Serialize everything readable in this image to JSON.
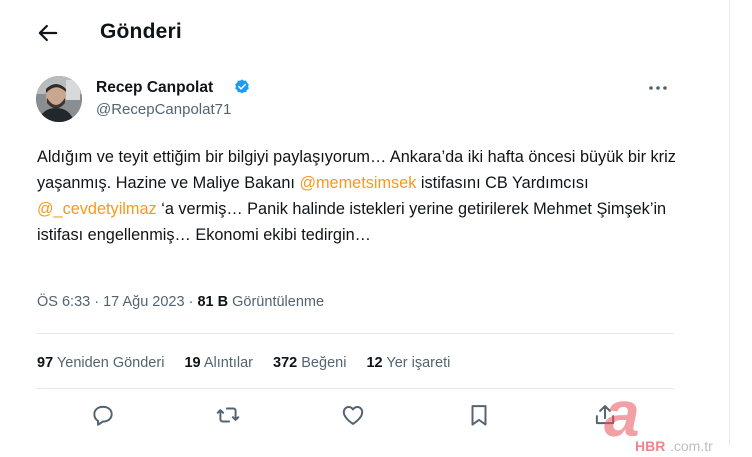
{
  "header": {
    "title": "Gönderi"
  },
  "author": {
    "name": "Recep Canpolat",
    "handle": "@RecepCanpolat71"
  },
  "tweet": {
    "segments": [
      {
        "text": "Aldığım ve teyit ettiğim bir bilgiyi paylaşıyorum… Ankara’da iki hafta öncesi büyük bir kriz yaşanmış. Hazine ve Maliye Bakanı ",
        "mention": false
      },
      {
        "text": "@memetsimsek",
        "mention": true
      },
      {
        "text": " istifasını CB Yardımcısı ",
        "mention": false
      },
      {
        "text": "@_cevdetyilmaz",
        "mention": true
      },
      {
        "text": " ‘a vermiş… Panik halinde istekleri yerine getirilerek Mehmet Şimşek’in istifası engellenmiş… Ekonomi ekibi tedirgin…",
        "mention": false
      }
    ]
  },
  "meta": {
    "time": "ÖS 6:33",
    "separator": "·",
    "date": "17 Ağu 2023",
    "views_count": "81 B",
    "views_label": "Görüntülenme"
  },
  "stats": [
    {
      "count": "97",
      "label": "Yeniden Gönderi"
    },
    {
      "count": "19",
      "label": "Alıntılar"
    },
    {
      "count": "372",
      "label": "Beğeni"
    },
    {
      "count": "12",
      "label": "Yer işareti"
    }
  ],
  "actions": [
    "reply-icon",
    "retweet-icon",
    "like-icon",
    "bookmark-icon",
    "share-icon"
  ],
  "watermark": {
    "letter": "a",
    "brand": "HBR",
    "domain": ".com.tr"
  },
  "colors": {
    "verified": "#1d9bf0",
    "mention": "#f59a1b",
    "muted": "#536471",
    "watermark": "#e8505b"
  }
}
